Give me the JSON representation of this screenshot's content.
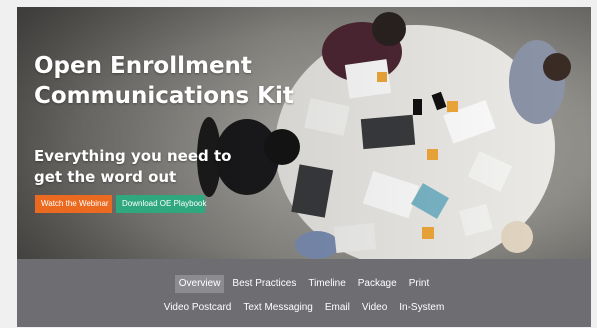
{
  "hero": {
    "title_line1": "Open Enrollment",
    "title_line2": "Communications Kit",
    "subtitle_line1": "Everything you need to",
    "subtitle_line2": "get the word out",
    "watch_button": "Watch the Webinar",
    "download_button": "Download OE Playbook"
  },
  "nav": {
    "row1": [
      "Overview",
      "Best Practices",
      "Timeline",
      "Package",
      "Print"
    ],
    "row2": [
      "Video Postcard",
      "Text Messaging",
      "Email",
      "Video",
      "In-System"
    ],
    "active": "Overview"
  },
  "colors": {
    "orange_button": "#ec6a1f",
    "green_button": "#2fa77f",
    "nav_background": "#6d6d72",
    "nav_active": "#8c8c90"
  }
}
